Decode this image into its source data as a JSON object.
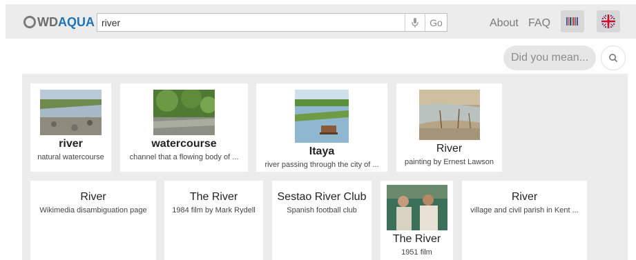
{
  "header": {
    "logo": {
      "prefix": "WD",
      "suffix": "AQUA"
    },
    "search": {
      "value": "river",
      "go_label": "Go"
    },
    "nav": {
      "about": "About",
      "faq": "FAQ"
    }
  },
  "suggestion": {
    "label": "Did you mean..."
  },
  "results": [
    {
      "title": "river",
      "description": "natural watercourse"
    },
    {
      "title": "watercourse",
      "description": "channel that a flowing body of ..."
    },
    {
      "title": "Itaya",
      "description": "river passing through the city of ..."
    },
    {
      "title": "River",
      "description": "painting by Ernest Lawson"
    },
    {
      "title": "River",
      "description": "Wikimedia disambiguation page"
    },
    {
      "title": "The River",
      "description": "1984 film by Mark Rydell"
    },
    {
      "title": "Sestao River Club",
      "description": "Spanish football club"
    },
    {
      "title": "The River",
      "description": "1951 film"
    },
    {
      "title": "River",
      "description": "village and civil parish in Kent ..."
    }
  ],
  "colors": {
    "brand": "#1f74b5",
    "panel": "#ececec"
  },
  "icons": [
    "microphone-icon",
    "barcode-icon",
    "uk-flag-icon",
    "search-icon"
  ]
}
